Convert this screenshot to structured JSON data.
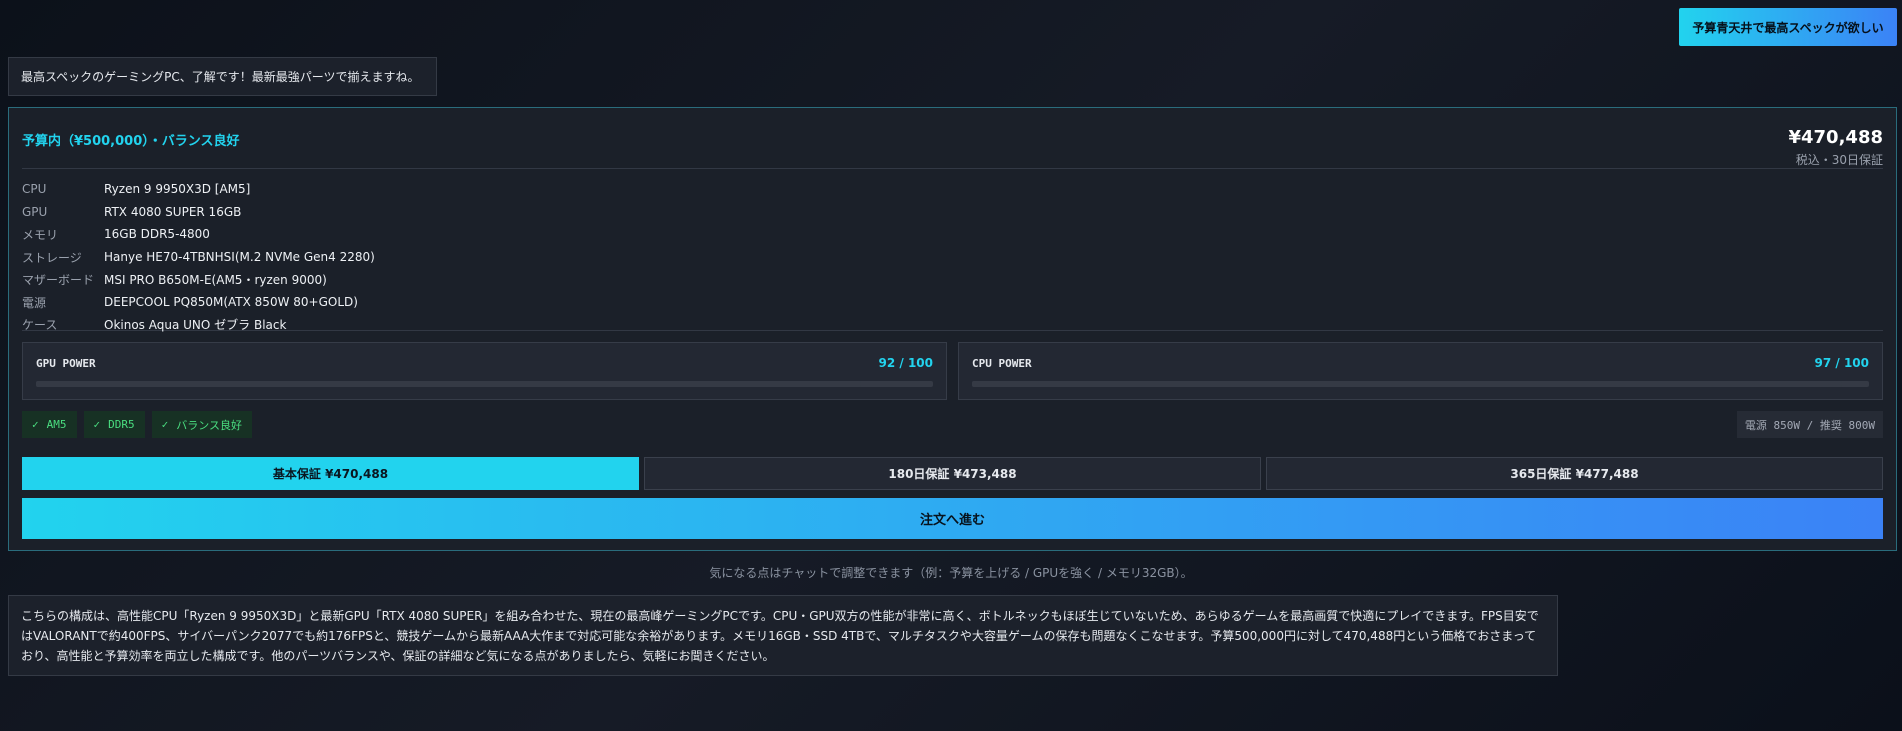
{
  "chat": {
    "user_request": "予算青天井で最高スペックが欲しい",
    "bot_reply": "最高スペックのゲーミングPC、了解です！最新最強パーツで揃えますね。",
    "hint": "気になる点はチャットで調整できます（例：予算を上げる / GPUを強く / メモリ32GB）。",
    "explanation": "こちらの構成は、高性能CPU「Ryzen 9 9950X3D」と最新GPU「RTX 4080 SUPER」を組み合わせた、現在の最高峰ゲーミングPCです。CPU・GPU双方の性能が非常に高く、ボトルネックもほぼ生じていないため、あらゆるゲームを最高画質で快適にプレイできます。FPS目安ではVALORANTで約400FPS、サイバーパンク2077でも約176FPSと、競技ゲームから最新AAA大作まで対応可能な余裕があります。メモリ16GB・SSD 4TBで、マルチタスクや大容量ゲームの保存も問題なくこなせます。予算500,000円に対して470,488円という価格でおさまっており、高性能と予算効率を両立した構成です。他のパーツバランスや、保証の詳細など気になる点がありましたら、気軽にお聞きください。"
  },
  "build": {
    "verdict": "予算内（¥500,000）・バランス良好",
    "price": "¥470,488",
    "price_note": "税込・30日保証",
    "specs": [
      {
        "label": "CPU",
        "value": "Ryzen 9 9950X3D [AM5]"
      },
      {
        "label": "GPU",
        "value": "RTX 4080 SUPER 16GB"
      },
      {
        "label": "メモリ",
        "value": "16GB DDR5-4800"
      },
      {
        "label": "ストレージ",
        "value": "Hanye HE70-4TBNHSI(M.2 NVMe Gen4 2280)"
      },
      {
        "label": "マザーボード",
        "value": "MSI PRO B650M-E(AM5・ryzen 9000)"
      },
      {
        "label": "電源",
        "value": "DEEPCOOL PQ850M(ATX 850W 80+GOLD)"
      },
      {
        "label": "ケース",
        "value": "Okinos Aqua UNO ゼブラ Black"
      }
    ],
    "meters": [
      {
        "label": "GPU POWER",
        "score": "92 / 100",
        "value": 0.92
      },
      {
        "label": "CPU POWER",
        "score": "97 / 100",
        "value": 0.97
      }
    ],
    "badges": [
      "AM5",
      "DDR5",
      "バランス良好"
    ],
    "badge_check": "✓",
    "power_note": "電源 850W / 推奨 800W",
    "warranty_options": [
      "基本保証 ¥470,488",
      "180日保証 ¥473,488",
      "365日保証 ¥477,488"
    ],
    "selected_warranty": 0,
    "order_label": "注文へ進む"
  },
  "colors": {
    "accent": "#22d3ee",
    "accent_end": "#3b82f6",
    "success": "#4ade80",
    "background": "#111722"
  }
}
